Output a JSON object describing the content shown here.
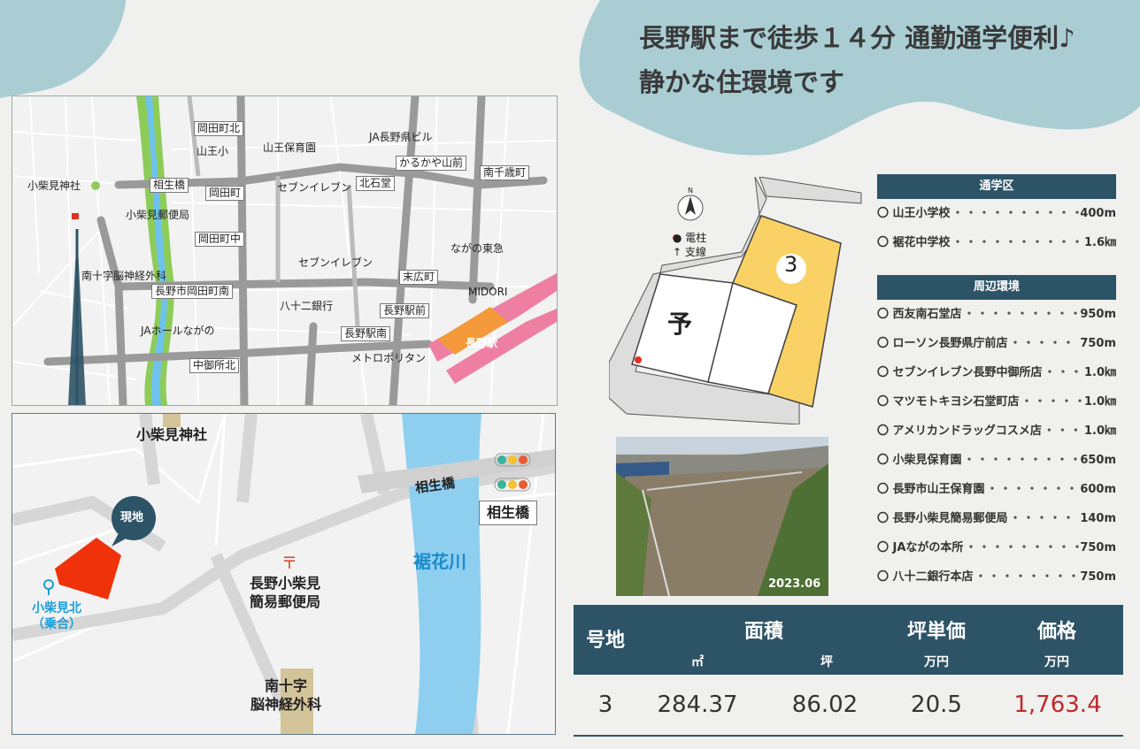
{
  "headline": {
    "line1": "長野駅まで徒歩１４分 通勤通学便利♪",
    "line2": "静かな住環境です"
  },
  "map_area": {
    "labels": [
      "岡田町北",
      "山王小",
      "山王保育園",
      "JA長野県ビル",
      "かるかや山前",
      "南千歳町",
      "小柴見神社",
      "相生橋",
      "岡田町",
      "セブンイレブン",
      "北石堂",
      "小柴見郵便局",
      "岡田町中",
      "ながの東急",
      "セブンイレブン",
      "末広町",
      "南十字脳神経外科",
      "長野市岡田町南",
      "八十二銀行",
      "MIDORI",
      "長野駅前",
      "JAホールながの",
      "長野駅南",
      "長野駅",
      "中御所北",
      "メトロポリタン"
    ],
    "detail_labels": {
      "shrine": "小柴見神社",
      "bridge": "相生橋",
      "bridge_box": "相生橋",
      "river": "裾花川",
      "site": "現地",
      "post_office": "長野小柴見\n簡易郵便局",
      "bus_stop": "小柴見北\n（乗合）",
      "hospital": "南十字\n脳神経外科"
    }
  },
  "plan": {
    "lot_number": "3",
    "reserved": "予",
    "north": "N",
    "legend_pole": "● 電柱",
    "legend_stay": "↑ 支線"
  },
  "photo": {
    "date": "2023.06"
  },
  "school": {
    "header": "通学区",
    "items": [
      {
        "name": "〇 山王小学校",
        "dist": "400m"
      },
      {
        "name": "〇 裾花中学校",
        "dist": "1.6㎞"
      }
    ]
  },
  "env": {
    "header": "周辺環境",
    "items": [
      {
        "name": "〇 西友南石堂店",
        "dist": "950m"
      },
      {
        "name": "〇 ローソン長野県庁前店",
        "dist": "750m"
      },
      {
        "name": "〇 セブンイレブン長野中御所店",
        "dist": "1.0㎞"
      },
      {
        "name": "〇 マツモトキヨシ石堂町店",
        "dist": "1.0㎞"
      },
      {
        "name": "〇 アメリカンドラッグコスメ店",
        "dist": "1.0㎞"
      },
      {
        "name": "〇 小柴見保育園",
        "dist": "650m"
      },
      {
        "name": "〇 長野市山王保育園",
        "dist": "600m"
      },
      {
        "name": "〇 長野小柴見簡易郵便局",
        "dist": "140m"
      },
      {
        "name": "〇 JAながの本所",
        "dist": "750m"
      },
      {
        "name": "〇 八十二銀行本店",
        "dist": "750m"
      }
    ]
  },
  "table": {
    "h_lot": "号地",
    "h_area": "面積",
    "h_unit_price": "坪単価",
    "h_price": "価格",
    "u_m2": "㎡",
    "u_tsubo": "坪",
    "u_man1": "万円",
    "u_man2": "万円",
    "row": {
      "lot": "3",
      "m2": "284.37",
      "tsubo": "86.02",
      "unit_price": "20.5",
      "price": "1,763.4"
    },
    "price_color": "#c0282c"
  }
}
